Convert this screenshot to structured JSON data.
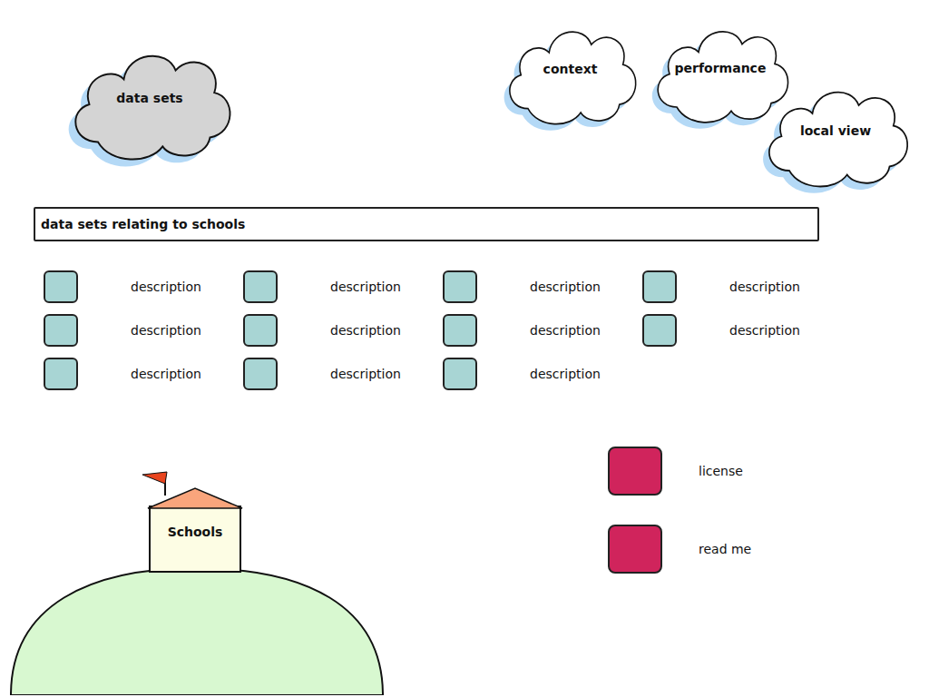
{
  "nav": [
    {
      "label": "data sets",
      "selected": true
    },
    {
      "label": "context",
      "selected": false
    },
    {
      "label": "performance",
      "selected": false
    },
    {
      "label": "local view",
      "selected": false
    }
  ],
  "section": {
    "title": "data sets relating to schools"
  },
  "datasets": [
    {
      "description": "description"
    },
    {
      "description": "description"
    },
    {
      "description": "description"
    },
    {
      "description": "description"
    },
    {
      "description": "description"
    },
    {
      "description": "description"
    },
    {
      "description": "description"
    },
    {
      "description": "description"
    },
    {
      "description": "description"
    },
    {
      "description": "description"
    },
    {
      "description": "description"
    }
  ],
  "school": {
    "label": "Schools"
  },
  "links": [
    {
      "label": "license"
    },
    {
      "label": "read me"
    }
  ]
}
